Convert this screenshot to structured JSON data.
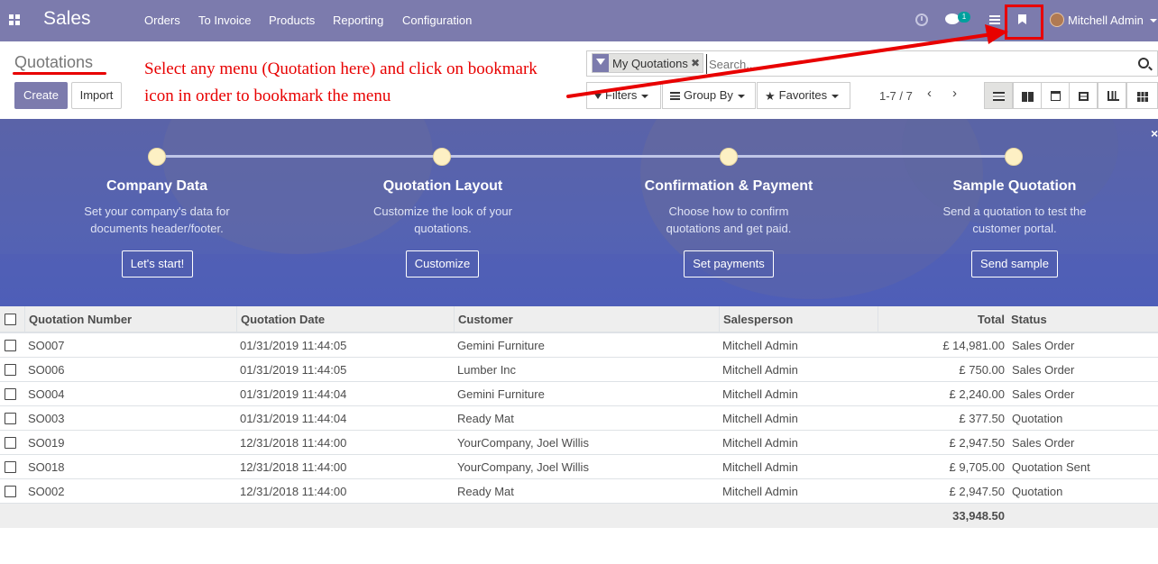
{
  "navbar": {
    "app_name": "Sales",
    "menu": [
      "Orders",
      "To Invoice",
      "Products",
      "Reporting",
      "Configuration"
    ],
    "chat_badge": "1",
    "user_name": "Mitchell Admin",
    "icons": [
      "apps-icon",
      "clock-icon",
      "chat-icon",
      "hamburger-icon",
      "bookmark-icon",
      "avatar"
    ]
  },
  "control_panel": {
    "title": "Quotations",
    "create_label": "Create",
    "import_label": "Import",
    "annotation_line1": "Select any menu (Quotation here) and click on bookmark",
    "annotation_line2": "icon in order to bookmark the menu",
    "facet_label": "My Quotations",
    "search_placeholder": "Search...",
    "filters_label": "Filters",
    "groupby_label": "Group By",
    "favorites_label": "Favorites",
    "pager": "1-7 / 7"
  },
  "onboarding": {
    "steps": [
      {
        "title": "Company Data",
        "desc": "Set your company's data for documents header/footer.",
        "button": "Let's start!"
      },
      {
        "title": "Quotation Layout",
        "desc": "Customize the look of your quotations.",
        "button": "Customize"
      },
      {
        "title": "Confirmation & Payment",
        "desc": "Choose how to confirm quotations and get paid.",
        "button": "Set payments"
      },
      {
        "title": "Sample Quotation",
        "desc": "Send a quotation to test the customer portal.",
        "button": "Send sample"
      }
    ],
    "close": "×"
  },
  "table": {
    "columns": [
      "Quotation Number",
      "Quotation Date",
      "Customer",
      "Salesperson",
      "Total",
      "Status"
    ],
    "rows": [
      {
        "number": "SO007",
        "date": "01/31/2019 11:44:05",
        "customer": "Gemini Furniture",
        "salesperson": "Mitchell Admin",
        "total": "£ 14,981.00",
        "status": "Sales Order"
      },
      {
        "number": "SO006",
        "date": "01/31/2019 11:44:05",
        "customer": "Lumber Inc",
        "salesperson": "Mitchell Admin",
        "total": "£ 750.00",
        "status": "Sales Order"
      },
      {
        "number": "SO004",
        "date": "01/31/2019 11:44:04",
        "customer": "Gemini Furniture",
        "salesperson": "Mitchell Admin",
        "total": "£ 2,240.00",
        "status": "Sales Order"
      },
      {
        "number": "SO003",
        "date": "01/31/2019 11:44:04",
        "customer": "Ready Mat",
        "salesperson": "Mitchell Admin",
        "total": "£ 377.50",
        "status": "Quotation"
      },
      {
        "number": "SO019",
        "date": "12/31/2018 11:44:00",
        "customer": "YourCompany, Joel Willis",
        "salesperson": "Mitchell Admin",
        "total": "£ 2,947.50",
        "status": "Sales Order"
      },
      {
        "number": "SO018",
        "date": "12/31/2018 11:44:00",
        "customer": "YourCompany, Joel Willis",
        "salesperson": "Mitchell Admin",
        "total": "£ 9,705.00",
        "status": "Quotation Sent"
      },
      {
        "number": "SO002",
        "date": "12/31/2018 11:44:00",
        "customer": "Ready Mat",
        "salesperson": "Mitchell Admin",
        "total": "£ 2,947.50",
        "status": "Quotation"
      }
    ],
    "grand_total": "33,948.50"
  },
  "colors": {
    "brand": "#7c7bad",
    "annotation": "#e80000",
    "banner": "#5563b2"
  }
}
